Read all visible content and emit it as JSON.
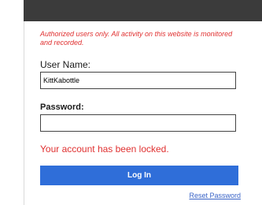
{
  "login": {
    "notice": "Authorized users only. All activity on this website is monitored and recorded.",
    "username_label": "User Name:",
    "username_value": "KittKabottle",
    "password_label": "Password:",
    "password_value": "",
    "error_message": "Your account has been locked.",
    "login_button": "Log In",
    "reset_link": "Reset Password"
  },
  "colors": {
    "top_bar": "#3b3b3b",
    "accent": "#2f6ed9",
    "error": "#e03131",
    "link": "#3a64c7"
  }
}
